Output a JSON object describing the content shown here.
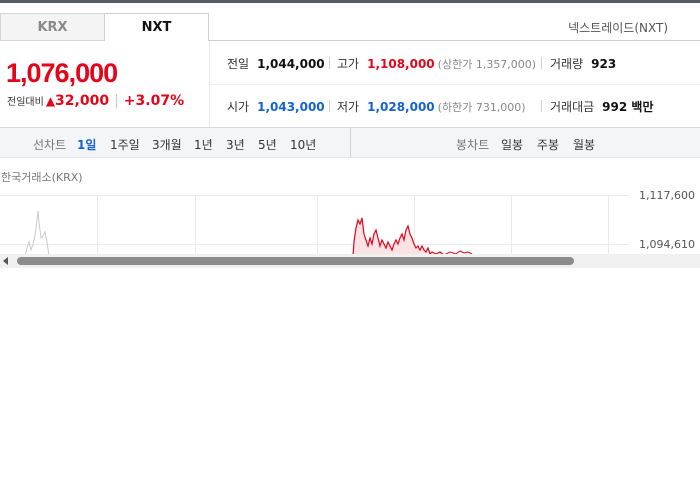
{
  "tabs": [
    {
      "label": "KRX",
      "active": false
    },
    {
      "label": "NXT",
      "active": true
    }
  ],
  "venue_label": "넥스트레이드(NXT)",
  "quote": {
    "price": "1,076,000",
    "change_label": "전일대비",
    "change_icon": "up-triangle-icon",
    "change_symbol": "▲",
    "change_amount": "32,000",
    "change_percent": "+3.07%"
  },
  "stats": {
    "prev_close": {
      "label": "전일",
      "value": "1,044,000"
    },
    "high": {
      "label": "고가",
      "value": "1,108,000",
      "sub": "(상한가 1,357,000)"
    },
    "volume": {
      "label": "거래량",
      "value": "923"
    },
    "open": {
      "label": "시가",
      "value": "1,043,000"
    },
    "low": {
      "label": "저가",
      "value": "1,028,000",
      "sub": "(하한가 731,000)"
    },
    "trade_value": {
      "label": "거래대금",
      "value": "992 백만"
    }
  },
  "toolbar": {
    "line_chart_label": "선차트",
    "periods": [
      "1일",
      "1주일",
      "3개월",
      "1년",
      "3년",
      "5년",
      "10년"
    ],
    "active_period": "1일",
    "candle_chart_label": "봉차트",
    "candle_periods": [
      "일봉",
      "주봉",
      "월봉"
    ]
  },
  "chart": {
    "source": "한국거래소(KRX)",
    "y_labels": [
      "1,117,600",
      "1,094,610"
    ]
  },
  "colors": {
    "up": "#e3061b",
    "down": "#1561d6",
    "active_tab": "#1561d6"
  }
}
